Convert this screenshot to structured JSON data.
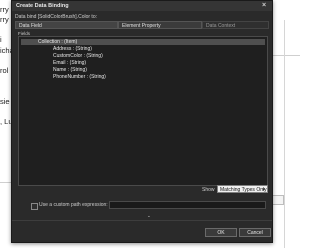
{
  "background": {
    "lines": [
      "rry",
      "rry",
      "i",
      "icha",
      "rol",
      "sie",
      ", Luc"
    ]
  },
  "dialog": {
    "title": "Create Data Binding",
    "close_glyph": "×",
    "subtitle": "Data bind [SolidColorBrush].Color to:",
    "columns": [
      "Data Field",
      "Element Property",
      "Data Context"
    ],
    "fields_label": "Fields",
    "tree": {
      "root": "Collection : (Item)",
      "children": [
        "Address : (String)",
        "CustomColor : (String)",
        "Email : (String)",
        "Name : (String)",
        "PhoneNumber : (String)"
      ]
    },
    "show_label": "Show",
    "show_value": "Matching Types Only",
    "custom_path_label": "Use a custom path expression:",
    "custom_path_checked": false,
    "custom_path_value": "",
    "expander_glyph": "⌄",
    "ok_label": "OK",
    "cancel_label": "Cancel"
  }
}
